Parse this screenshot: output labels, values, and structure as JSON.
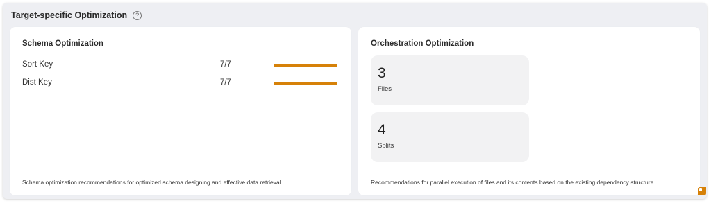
{
  "header": {
    "title": "Target-specific Optimization",
    "help_icon": "question-circle-icon"
  },
  "schema": {
    "title": "Schema Optimization",
    "rows": [
      {
        "label": "Sort Key",
        "value": "7/7",
        "progress": 1.0
      },
      {
        "label": "Dist Key",
        "value": "7/7",
        "progress": 1.0
      }
    ],
    "footer": "Schema optimization recommendations for optimized schema designing and effective data retrieval."
  },
  "orchestration": {
    "title": "Orchestration Optimization",
    "tiles": [
      {
        "number": "3",
        "label": "Files"
      },
      {
        "number": "4",
        "label": "Splits"
      }
    ],
    "footer": "Recommendations for parallel execution of files and its contents based on the existing dependency structure."
  },
  "colors": {
    "accent": "#d68108",
    "panel_bg": "#eeeff3",
    "card_bg": "#ffffff",
    "tile_bg": "#f2f2f3"
  }
}
